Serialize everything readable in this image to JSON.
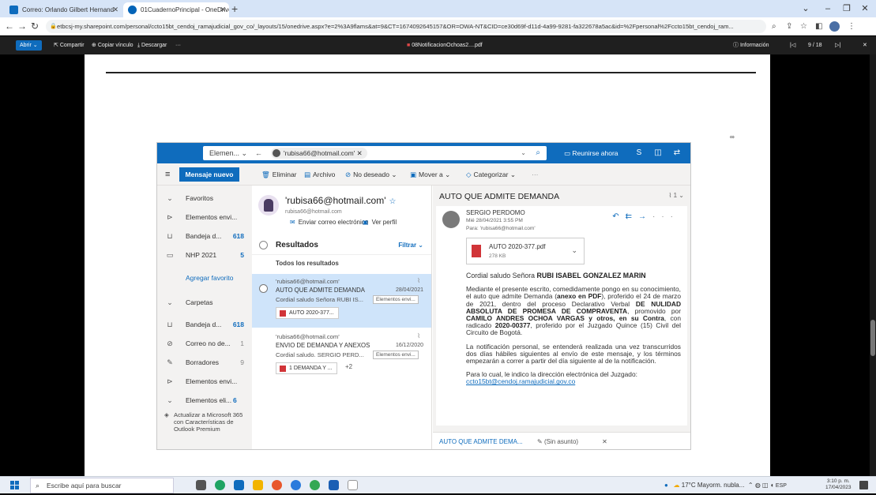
{
  "browser": {
    "tabs": [
      {
        "label": "Correo: Orlando Gilbert Hernand"
      },
      {
        "label": "01CuadernoPrincipal - OneDrive"
      }
    ],
    "url": "etbcsj-my.sharepoint.com/personal/ccto15bt_cendoj_ramajudicial_gov_co/_layouts/15/onedrive.aspx?e=2%3A9flams&at=9&CT=1674092645157&OR=OWA-NT&CID=ce30d69f-d11d-4a99-9281-fa322678a5ac&id=%2Fpersonal%2Fccto15bt_cendoj_ram..."
  },
  "viewer_toolbar": {
    "open_label": "Abrir",
    "share_label": "Compartir",
    "copy_link_label": "Copiar vínculo",
    "download_label": "Descargar",
    "more_label": "···",
    "file_name": "08NotificacionOchoas2....pdf",
    "info_label": "Información",
    "page_indicator": "9 / 18"
  },
  "page_mark": "∞",
  "outlook": {
    "search_scope": "Elemen...",
    "search_pill": "'rubisa66@hotmail.com'",
    "meet_now": "Reunirse ahora",
    "new_mail": "Mensaje nuevo",
    "commands": {
      "delete": "Eliminar",
      "archive": "Archivo",
      "junk": "No deseado",
      "move": "Mover a",
      "categorize": "Categorizar",
      "more": "···"
    },
    "nav": {
      "favorites": "Favoritos",
      "items_sent_fav": "Elementos envi...",
      "inbox_fav": {
        "label": "Bandeja d...",
        "count": "618"
      },
      "nhp": {
        "label": "NHP 2021",
        "count": "5"
      },
      "add_favorite": "Agregar favorito",
      "folders": "Carpetas",
      "inbox": {
        "label": "Bandeja d...",
        "count": "618"
      },
      "junk": {
        "label": "Correo no de...",
        "count": "1"
      },
      "drafts": {
        "label": "Borradores",
        "count": "9"
      },
      "sent": "Elementos envi...",
      "deleted": {
        "label": "Elementos eli...",
        "count": "6"
      },
      "upgrade": "Actualizar a Microsoft 365 con Características de Outlook Premium"
    },
    "contact": {
      "name": "'rubisa66@hotmail.com'",
      "email": "rubisa66@hotmail.com",
      "send_email": "Enviar correo electrónico",
      "view_profile": "Ver perfil"
    },
    "results_title": "Resultados",
    "filter_label": "Filtrar",
    "all_results": "Todos los resultados",
    "messages": [
      {
        "from": "'rubisa66@hotmail.com'",
        "subject": "AUTO QUE ADMITE DEMANDA",
        "date": "28/04/2021",
        "preview": "Cordial saludo Señora RUBI IS...",
        "tag": "Elementos envi...",
        "attachment": "AUTO 2020-377...",
        "extra": ""
      },
      {
        "from": "'rubisa66@hotmail.com'",
        "subject": "ENVIO DE DEMANDA Y ANEXOS",
        "date": "16/12/2020",
        "preview": "Cordial saludo. SERGIO PERD...",
        "tag": "Elementos envi...",
        "attachment": "1 DEMANDA Y ...",
        "extra": "+2"
      }
    ],
    "reading": {
      "subject": "AUTO QUE ADMITE DEMANDA",
      "count": "1",
      "sender": "SERGIO PERDOMO",
      "date": "Mié 28/04/2021 3:55 PM",
      "to": "Para: 'rubisa66@hotmail.com'",
      "attachment_name": "AUTO 2020-377.pdf",
      "attachment_size": "278 KB",
      "greeting_pre": "Cordial saludo Señora ",
      "greeting_name": "RUBI ISABEL GONZALEZ MARIN",
      "p1_a": "Mediante el presente escrito, comedidamente pongo en su conocimiento, el auto que admite Demanda (",
      "p1_b": "anexo en PDF",
      "p1_c": "), proferido el 24 de marzo de 2021, dentro del proceso Declarativo Verbal ",
      "p1_d": "DE NULIDAD ABSOLUTA DE PROMESA DE COMPRAVENTA",
      "p1_e": ", promovido por ",
      "p1_f": "CAMILO ANDRES OCHOA VARGAS y otros, en su Contra",
      "p1_g": ", con radicado ",
      "p1_h": "2020-00377",
      "p1_i": ", proferido por el Juzgado Quince (15) Civil del Circuito de Bogotá.",
      "p2": "La notificación personal, se entenderá realizada una vez transcurridos dos días hábiles siguientes al envío de este mensaje, y los términos empezarán a correr a partir del día siguiente al de la notificación.",
      "p3": "Para lo cual, le indico la dirección electrónica del Juzgado:",
      "email_link": "ccto15bt@cendoj.ramajudicial.gov.co",
      "tab1": "AUTO QUE ADMITE DEMA...",
      "tab2": "(Sin asunto)"
    }
  },
  "taskbar": {
    "search_placeholder": "Escribe aquí para buscar",
    "weather": "17°C  Mayorm. nubla...",
    "lang": "ESP",
    "time": "3:10 p. m.",
    "date": "17/04/2023"
  }
}
